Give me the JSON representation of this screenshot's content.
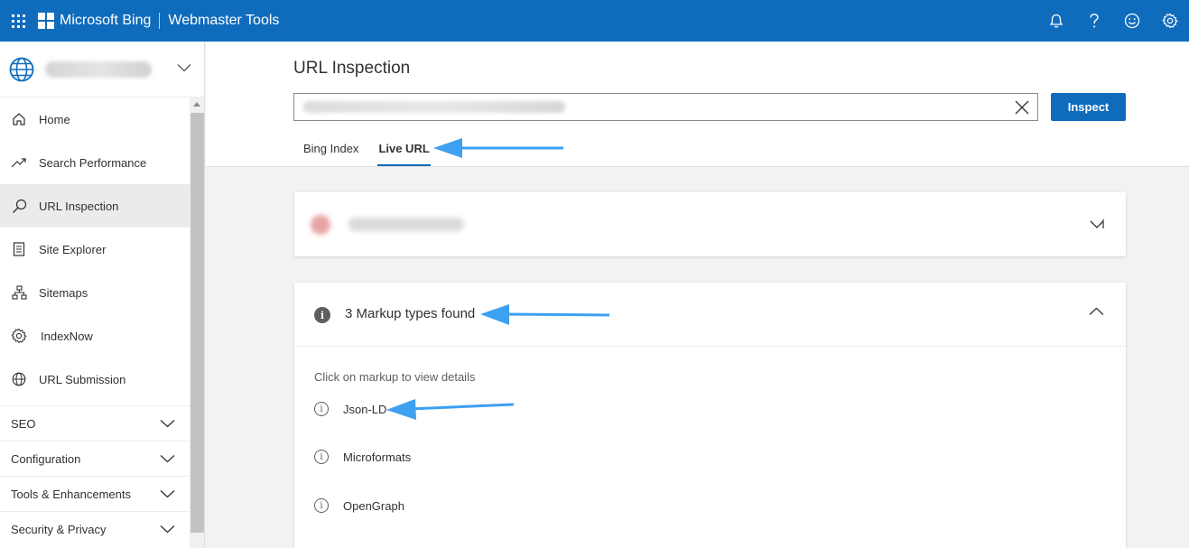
{
  "header": {
    "brand": "Microsoft Bing",
    "product": "Webmaster Tools",
    "icons": [
      "bell-icon",
      "help-icon",
      "feedback-smiley-icon",
      "settings-gear-icon"
    ]
  },
  "sidebar": {
    "site_icon": "globe-icon",
    "items": [
      {
        "label": "Home",
        "icon": "home-icon"
      },
      {
        "label": "Search Performance",
        "icon": "trend-icon"
      },
      {
        "label": "URL Inspection",
        "icon": "search-icon",
        "active": true
      },
      {
        "label": "Site Explorer",
        "icon": "document-icon"
      },
      {
        "label": "Sitemaps",
        "icon": "sitemap-icon"
      },
      {
        "label": "IndexNow",
        "icon": "gear-icon"
      },
      {
        "label": "URL Submission",
        "icon": "globe-icon"
      }
    ],
    "groups": [
      {
        "label": "SEO"
      },
      {
        "label": "Configuration"
      },
      {
        "label": "Tools & Enhancements"
      },
      {
        "label": "Security & Privacy"
      }
    ]
  },
  "main": {
    "title": "URL Inspection",
    "inspect_label": "Inspect",
    "tabs": [
      {
        "label": "Bing Index",
        "active": false
      },
      {
        "label": "Live URL",
        "active": true
      }
    ],
    "markup_card": {
      "title": "3 Markup types found",
      "hint": "Click on markup to view details",
      "items": [
        "Json-LD",
        "Microformats",
        "OpenGraph"
      ]
    }
  },
  "colors": {
    "brand_blue": "#0f6cbd",
    "annotation_arrow": "#3ea0f0"
  }
}
